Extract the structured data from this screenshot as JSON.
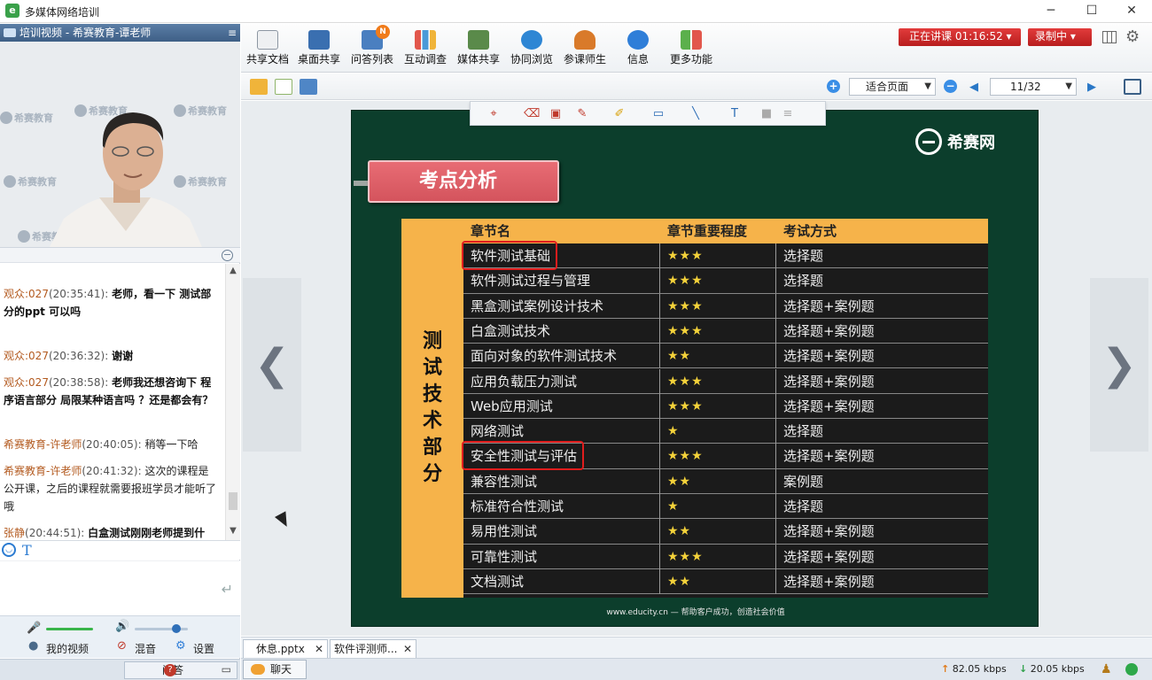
{
  "window": {
    "title": "多媒体网络培训",
    "logo": "e"
  },
  "left_panel": {
    "video_header": "培训视频 - 希赛教育-谭老师",
    "video_watermark": "希赛教育",
    "chat": [
      {
        "name": "观众:027",
        "time": "(20:35:41):",
        "text": "老师，看一下 测试部分的ppt 可以吗",
        "bold": true
      },
      {
        "name": "观众:027",
        "time": "(20:36:32):",
        "text": "谢谢",
        "bold": true
      },
      {
        "name": "观众:027",
        "time": "(20:38:58):",
        "text": "老师我还想咨询下 程序语言部分 局限某种语言吗 ？还是都会有？",
        "bold": true
      },
      {
        "name": "希赛教育-许老师",
        "time": "(20:40:05):",
        "text": "稍等一下哈",
        "bold": false
      },
      {
        "name": "希赛教育-许老师",
        "time": "(20:41:32):",
        "text": "这次的课程是公开课，之后的课程就需要报班学员才能听了哦",
        "bold": false
      },
      {
        "name": "张静",
        "time": "(20:44:51):",
        "text": "白盒测试刚刚老师提到什么，网络刚刚卡，没听清楚",
        "bold": true
      }
    ],
    "mic_level": 0.95,
    "speaker_level": 0.7,
    "my_video": "我的视频",
    "mix": "混音",
    "settings": "设置",
    "qa_button": "问答"
  },
  "toolbar": {
    "items": [
      {
        "label": "共享文档",
        "icon": "document-icon",
        "color": "#7a8796"
      },
      {
        "label": "桌面共享",
        "icon": "desktop-share-icon",
        "color": "#3a6fb0"
      },
      {
        "label": "问答列表",
        "icon": "qa-list-icon",
        "color": "#4a7fc0",
        "badge": "N"
      },
      {
        "label": "互动调查",
        "icon": "bar-chart-icon",
        "color": "#e2574c"
      },
      {
        "label": "媒体共享",
        "icon": "media-icon",
        "color": "#5a8a4a"
      },
      {
        "label": "协同浏览",
        "icon": "browser-icon",
        "color": "#2e86d4"
      },
      {
        "label": "参课师生",
        "icon": "users-icon",
        "color": "#d97a2a"
      },
      {
        "label": "信息",
        "icon": "info-icon",
        "color": "#2f7ed8"
      },
      {
        "label": "更多功能",
        "icon": "grid-apps-icon",
        "color": "#5bb04c"
      }
    ],
    "live": "正在讲课 01:16:52 ▾",
    "recording": "录制中 ▾"
  },
  "docbar": {
    "zoom": "适合页面",
    "page": "11/32"
  },
  "slide": {
    "brand": "希赛网",
    "section_title": "考点分析",
    "vertical_label": "测试技术部分",
    "columns": [
      "章节名",
      "章节重要程度",
      "考试方式"
    ],
    "rows": [
      {
        "name": "软件测试基础",
        "stars": "★★★",
        "mode": "选择题",
        "hl": true
      },
      {
        "name": "软件测试过程与管理",
        "stars": "★★★",
        "mode": "选择题"
      },
      {
        "name": "黑盒测试案例设计技术",
        "stars": "★★★",
        "mode": "选择题+案例题"
      },
      {
        "name": "白盒测试技术",
        "stars": "★★★",
        "mode": "选择题+案例题"
      },
      {
        "name": "面向对象的软件测试技术",
        "stars": "★★",
        "mode": "选择题+案例题"
      },
      {
        "name": "应用负载压力测试",
        "stars": "★★★",
        "mode": "选择题+案例题"
      },
      {
        "name": "Web应用测试",
        "stars": "★★★",
        "mode": "选择题+案例题"
      },
      {
        "name": "网络测试",
        "stars": "★",
        "mode": "选择题"
      },
      {
        "name": "安全性测试与评估",
        "stars": "★★★",
        "mode": "选择题+案例题",
        "hl": true
      },
      {
        "name": "兼容性测试",
        "stars": "★★",
        "mode": "案例题"
      },
      {
        "name": "标准符合性测试",
        "stars": "★",
        "mode": "选择题"
      },
      {
        "name": "易用性测试",
        "stars": "★★",
        "mode": "选择题+案例题"
      },
      {
        "name": "可靠性测试",
        "stars": "★★★",
        "mode": "选择题+案例题"
      },
      {
        "name": "文档测试",
        "stars": "★★",
        "mode": "选择题+案例题"
      }
    ],
    "footer": "www.educity.cn — 帮助客户成功，创造社会价值"
  },
  "tabs": [
    {
      "label": "休息.pptx"
    },
    {
      "label": "软件评测师..."
    }
  ],
  "status": {
    "chat": "聊天",
    "up_rate": "82.05 kbps",
    "down_rate": "20.05 kbps"
  }
}
